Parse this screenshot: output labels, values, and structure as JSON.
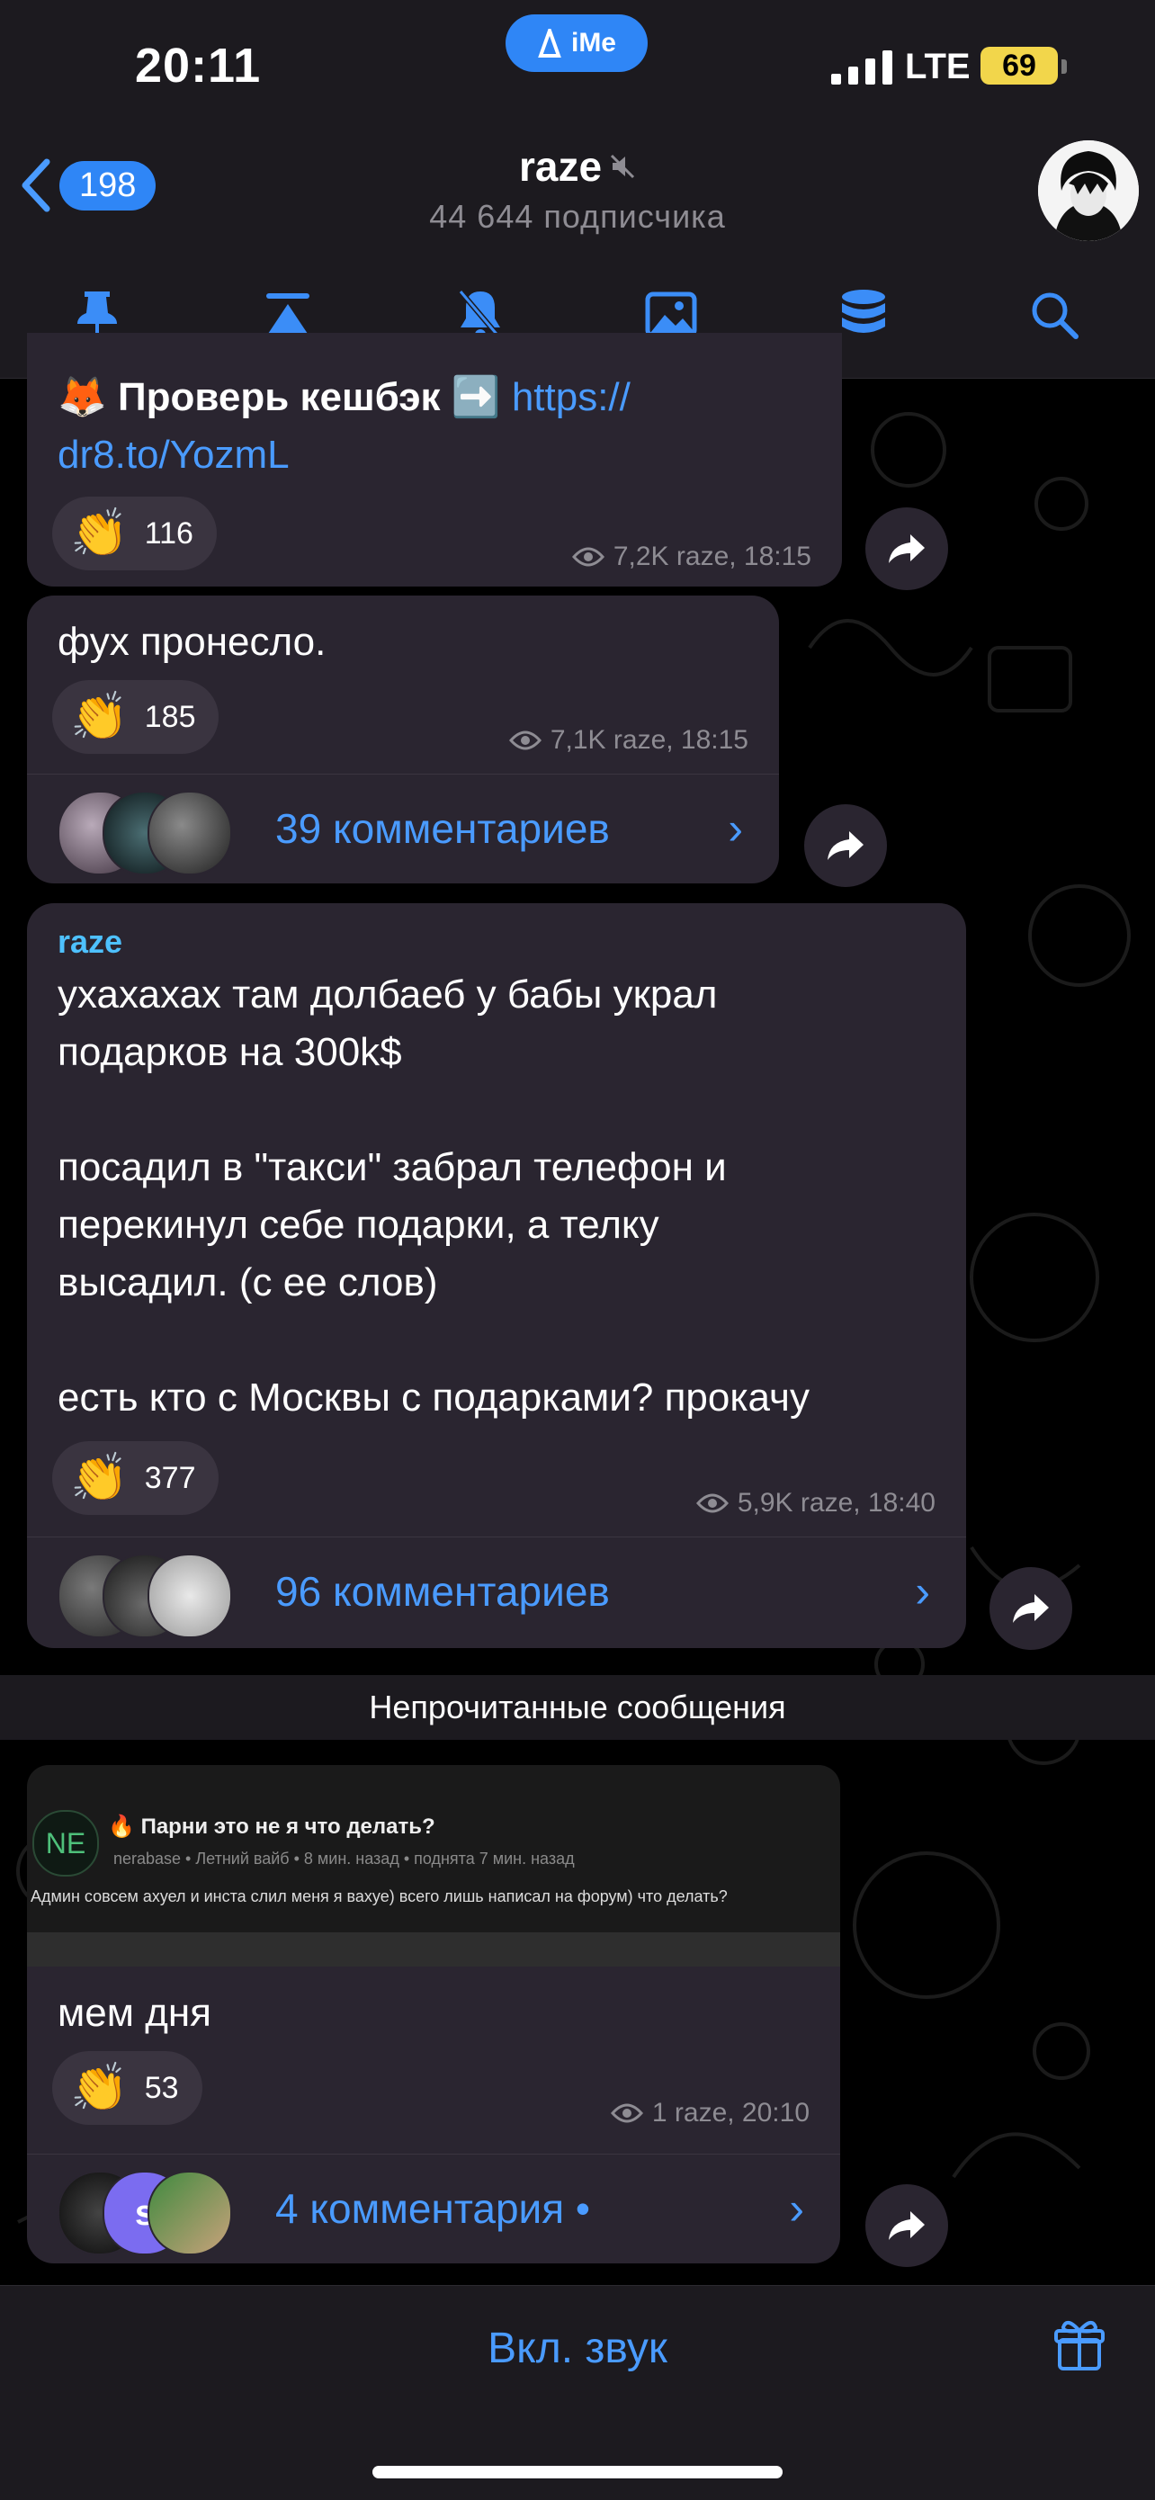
{
  "status": {
    "time": "20:11",
    "pill": "iMe",
    "network": "LTE",
    "battery": "69"
  },
  "header": {
    "back_count": "198",
    "channel_name": "raze",
    "subscribers": "44 644 подписчика",
    "toolbar": [
      "pin-icon",
      "scroll-top-icon",
      "mute-bell-icon",
      "media-icon",
      "storage-icon",
      "search-icon"
    ]
  },
  "messages": [
    {
      "text_prefix": "🦊 Проверь кешбэк ➡️",
      "link_part1": "https://",
      "link_part2": "dr8.to/YozmL",
      "reaction": "116",
      "meta": "7,2K raze, 18:15"
    },
    {
      "text": "фух пронесло.",
      "reaction": "185",
      "meta": "7,1K raze, 18:15",
      "comments": "39 комментариев"
    },
    {
      "author": "raze",
      "lines": [
        "ухахахах там долбаеб у бабы украл",
        "подарков на 300k$",
        "",
        "посадил в \"такси\" забрал телефон и",
        "перекинул себе подарки, а телку",
        "высадил. (с ее слов)",
        "",
        "есть кто с Москвы с подарками? прокачу"
      ],
      "reaction": "377",
      "meta": "5,9K raze, 18:40",
      "comments": "96 комментариев"
    },
    {
      "screenshot": {
        "avatar": "NE",
        "title": "Парни это не я что делать?",
        "sub": "nerabase • Летний вайб • 8 мин. назад • поднята 7 мин. назад",
        "body": "Админ совсем ахуел и инста слил меня я вахуе) всего лишь написал на форум) что делать?"
      },
      "text": "мем дня",
      "reaction": "53",
      "meta": "1 raze, 20:10",
      "comments": "4 комментария •"
    }
  ],
  "unread_label": "Непрочитанные сообщения",
  "bottom": {
    "unmute": "Вкл. звук"
  }
}
